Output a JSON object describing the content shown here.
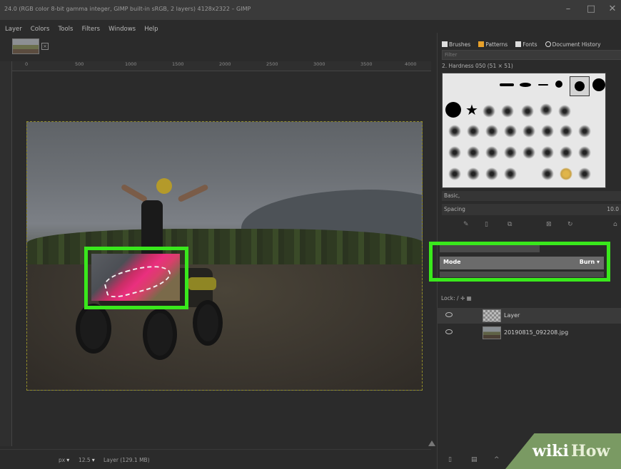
{
  "window": {
    "title": "24.0 (RGB color 8-bit gamma integer, GIMP built-in sRGB, 2 layers) 4128x2322 – GIMP",
    "minimize": "–",
    "maximize": "□",
    "close": "✕"
  },
  "menu": [
    "Layer",
    "Colors",
    "Tools",
    "Filters",
    "Windows",
    "Help"
  ],
  "tab_close": "×",
  "ruler_ticks": [
    "0",
    "500",
    "1000",
    "1500",
    "2000",
    "2500",
    "3000",
    "3500",
    "4000"
  ],
  "statusbar": {
    "unit": "px",
    "zoom": "12.5",
    "layer_info": "Layer (129.1 MB)"
  },
  "dock": {
    "tabs": [
      {
        "label": "Brushes",
        "color": "#ffffff"
      },
      {
        "label": "Patterns",
        "color": "#e8a12a"
      },
      {
        "label": "Fonts",
        "color": "#ffffff"
      },
      {
        "label": "Document History",
        "color": "#ffffff"
      }
    ],
    "filter_placeholder": "Filter",
    "brush_name": "2. Hardness 050 (51 × 51)",
    "tag": "Basic,",
    "spacing_label": "Spacing",
    "spacing_value": "10.0"
  },
  "layer_mode": {
    "label": "Mode",
    "value": "Burn"
  },
  "lock_label": "Lock:",
  "layers": [
    {
      "name": "Layer",
      "selected": true
    },
    {
      "name": "20190815_092208.jpg",
      "selected": false
    }
  ],
  "watermark": {
    "wiki": "wiki",
    "how": "How"
  },
  "colors": {
    "highlight": "#39e81c",
    "burn_pink": "#ea2f7e"
  }
}
